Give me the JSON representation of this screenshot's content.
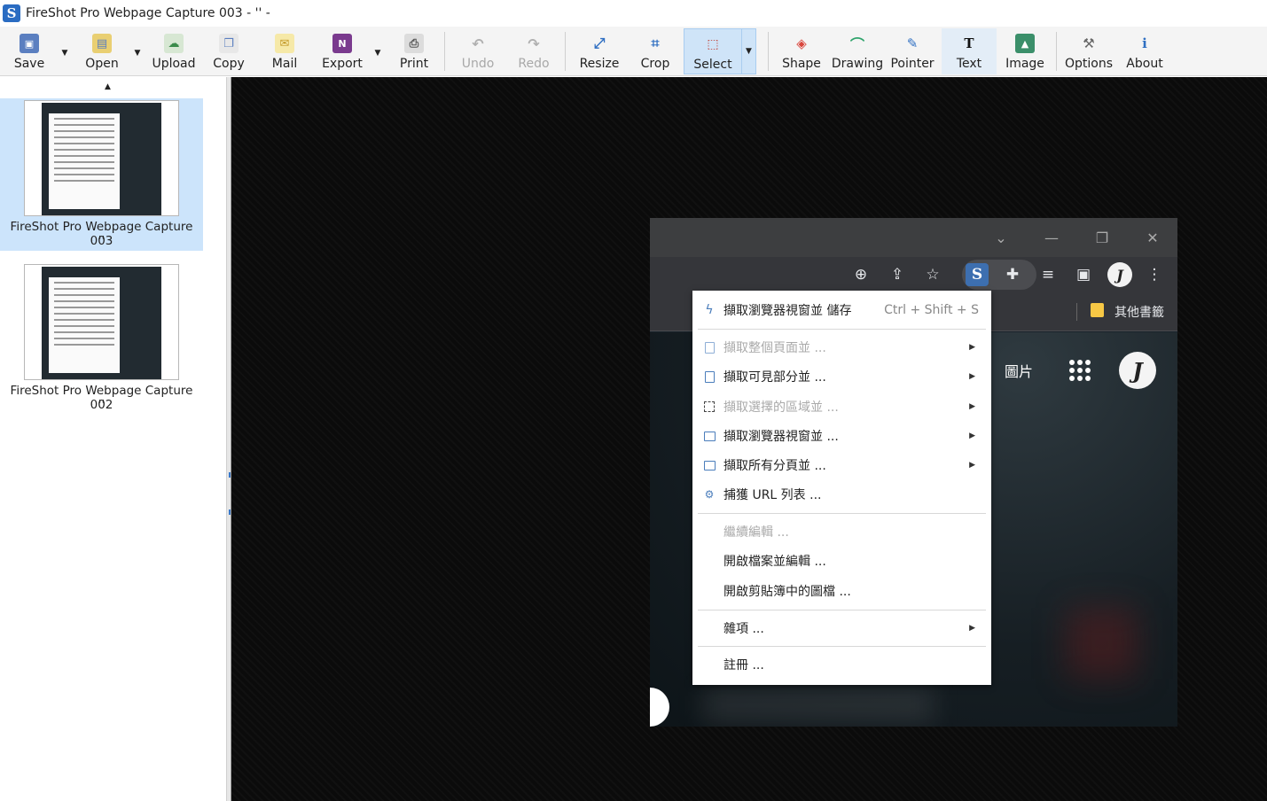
{
  "window": {
    "title": "FireShot Pro Webpage Capture 003 - '' -",
    "logo_letter": "S"
  },
  "toolbar": {
    "save": "Save",
    "open": "Open",
    "upload": "Upload",
    "copy": "Copy",
    "mail": "Mail",
    "export": "Export",
    "print": "Print",
    "undo": "Undo",
    "redo": "Redo",
    "resize": "Resize",
    "crop": "Crop",
    "select": "Select",
    "shape": "Shape",
    "drawing": "Drawing",
    "pointer": "Pointer",
    "text": "Text",
    "image": "Image",
    "options": "Options",
    "about": "About"
  },
  "captures": [
    {
      "title": "FireShot Pro Webpage Capture 003",
      "subtitle": "- '' -"
    },
    {
      "title": "FireShot Pro Webpage Capture 002",
      "subtitle": "- '' -"
    }
  ],
  "browser": {
    "bookmark_folder": "其他書籤",
    "page_images_link": "圖片",
    "avatar_letter": "J"
  },
  "menu": {
    "item1": {
      "label": "擷取瀏覽器視窗並 儲存",
      "shortcut": "Ctrl + Shift + S"
    },
    "item2": "擷取整個頁面並 ...",
    "item3": "擷取可見部分並 ...",
    "item4": "擷取選擇的區域並 ...",
    "item5": "擷取瀏覽器視窗並 ...",
    "item6": "擷取所有分頁並 ...",
    "item7": "捕獲 URL 列表 ...",
    "item8": "繼續編輯 ...",
    "item9": "開啟檔案並編輯 ...",
    "item10": "開啟剪貼簿中的圖檔 ...",
    "item11": "雜項 ...",
    "item12": "註冊 ..."
  }
}
